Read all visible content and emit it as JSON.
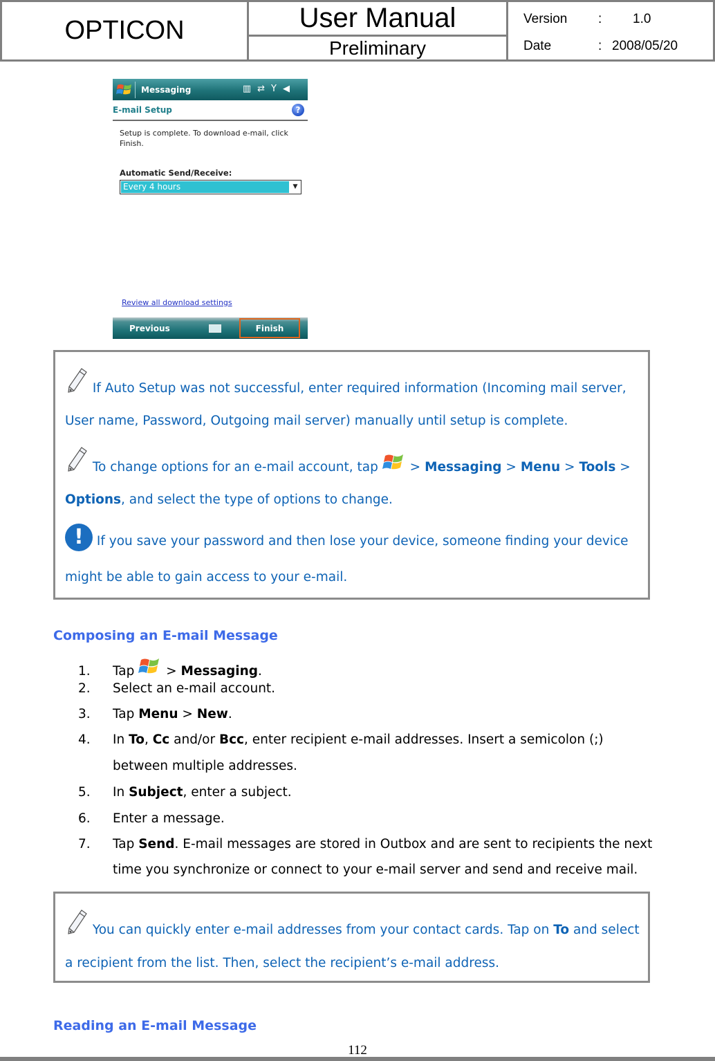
{
  "header": {
    "brand": "OPTICON",
    "title": "User Manual",
    "subtitle": "Preliminary",
    "version_label": "Version",
    "version_value": "1.0",
    "date_label": "Date",
    "date_value": "2008/05/20",
    "colon": ":"
  },
  "device": {
    "app_title": "Messaging",
    "status_icons": [
      "barcode-icon",
      "connectivity-icon",
      "signal-icon",
      "volume-icon"
    ],
    "page_title": "E-mail Setup",
    "help_glyph": "?",
    "message": "Setup is complete.  To download e-mail, click Finish.",
    "field_label": "Automatic Send/Receive:",
    "field_value": "Every 4 hours",
    "dropdown_glyph": "▼",
    "link": "Review all download settings",
    "softkey_left": "Previous",
    "softkey_right": "Finish",
    "colors": {
      "titlebar": "#1f7378",
      "accent": "#1f7e8a",
      "highlight": "#2fc1d2",
      "callout": "#e0661e"
    }
  },
  "note1": {
    "line1": "If Auto Setup was not successful, enter required information (Incoming mail server,",
    "line2": "User name, Password, Outgoing mail server) manually until setup is complete.",
    "line3_pre": "To change options for an e-mail account, tap",
    "sep": ">",
    "messaging": "Messaging",
    "menu": "Menu",
    "tools": "Tools",
    "options": "Options",
    "line4_post": ", and select the type of options to change.",
    "warn_glyph": "!",
    "line5": "If you save your password and then lose your device, someone finding your device",
    "line6": "might be able to gain access to your e-mail."
  },
  "section1": {
    "heading": "Composing an E-mail Message",
    "steps": [
      {
        "num": "1.",
        "pre": "Tap",
        "sep": ">",
        "bold": "Messaging",
        "post": "."
      },
      {
        "num": "2.",
        "text": "Select an e-mail account."
      },
      {
        "num": "3.",
        "pre": "Tap ",
        "b1": "Menu",
        "sep": " > ",
        "b2": "New",
        "post": "."
      },
      {
        "num": "4.",
        "pre": "In ",
        "b1": "To",
        "c1": ", ",
        "b2": "Cc",
        "c2": " and/or ",
        "b3": "Bcc",
        "post": ", enter recipient e-mail addresses. Insert a semicolon (;)",
        "cont": "between multiple addresses."
      },
      {
        "num": "5.",
        "pre": "In ",
        "bold": "Subject",
        "post": ", enter a subject."
      },
      {
        "num": "6.",
        "text": "Enter a message."
      },
      {
        "num": "7.",
        "pre": "Tap ",
        "bold": "Send",
        "post": ". E-mail messages are stored in Outbox and are sent to recipients the next",
        "cont": "time you synchronize or connect to your e-mail server and send and receive mail."
      }
    ]
  },
  "note2": {
    "line1_pre": "You can quickly enter e-mail addresses from your contact cards. Tap on",
    "bold": "To",
    "line1_post": "and select",
    "line2": "a recipient from the list. Then, select the recipient’s e-mail address."
  },
  "section2": {
    "heading": "Reading an E-mail Message"
  },
  "footer": {
    "page_number": "112"
  }
}
